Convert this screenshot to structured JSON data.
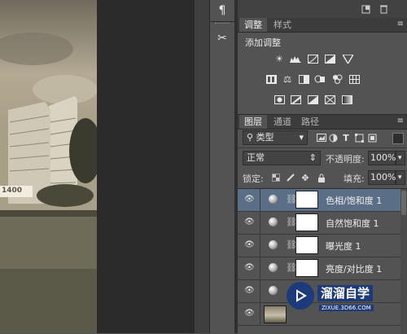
{
  "tools": {
    "paragraph_icon": "¶",
    "scissors_icon": "✂"
  },
  "adjustments": {
    "tabs": [
      {
        "label": "调整"
      },
      {
        "label": "样式"
      }
    ],
    "title": "添加调整"
  },
  "layers": {
    "tabs": [
      {
        "label": "图层"
      },
      {
        "label": "通道"
      },
      {
        "label": "路径"
      }
    ],
    "filter": {
      "label": "类型",
      "icon": "search-icon"
    },
    "blend_mode": "正常",
    "opacity_label": "不透明度:",
    "opacity_value": "100%",
    "lock_label": "锁定:",
    "fill_label": "填充:",
    "fill_value": "100%",
    "items": [
      {
        "name": "色相/饱和度 1",
        "selected": true
      },
      {
        "name": "自然饱和度 1",
        "selected": false
      },
      {
        "name": "曝光度 1",
        "selected": false
      },
      {
        "name": "亮度/对比度 1",
        "selected": false
      },
      {
        "name": "",
        "selected": false
      },
      {
        "name": "",
        "selected": false
      }
    ]
  },
  "watermark": {
    "title": "溜溜自学",
    "subtitle": "ZIXUE.3D66.COM"
  },
  "canvas_sign": "1400",
  "colors": {
    "panel": "#535353",
    "selected_row": "#5a6e86",
    "tab_bar": "#3c3c3c",
    "watermark": "#1d3a7a"
  }
}
